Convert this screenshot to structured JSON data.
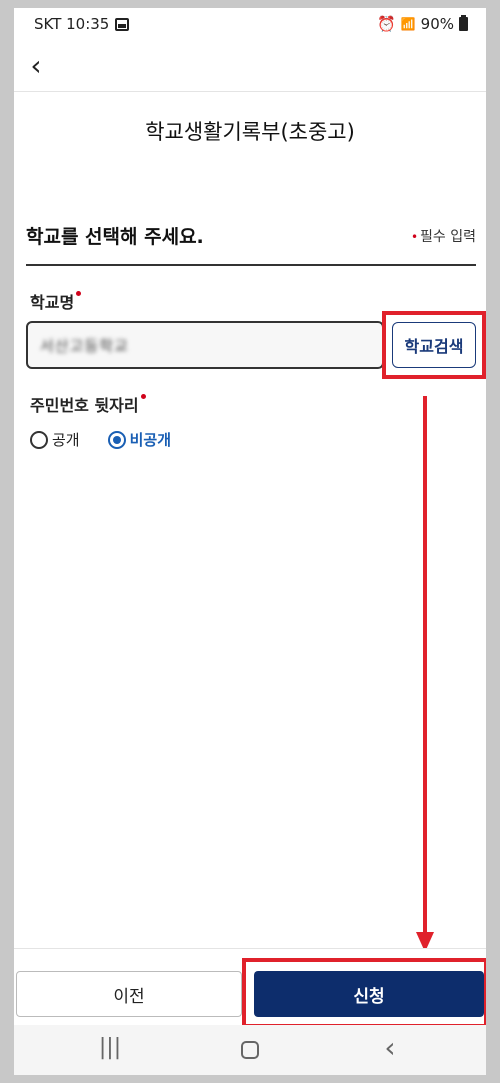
{
  "status_bar": {
    "carrier_time": "SKT 10:35",
    "battery": "90%",
    "icons": [
      "gallery-icon",
      "alarm-icon",
      "wifi-icon",
      "signal-icon",
      "battery-icon"
    ]
  },
  "app_bar": {
    "back_icon": "chevron-left-icon",
    "back_glyph": "‹"
  },
  "page": {
    "title": "학교생활기록부(초중고)"
  },
  "section": {
    "title": "학교를 선택해 주세요.",
    "required_note": "필수 입력",
    "required_dot": "•"
  },
  "school_field": {
    "label": "학교명",
    "value": "서산고등학교",
    "search_button": "학교검색"
  },
  "id_field": {
    "label": "주민번호 뒷자리",
    "options": [
      "공개",
      "비공개"
    ],
    "selected": "비공개"
  },
  "footer": {
    "prev_label": "이전",
    "apply_label": "신청"
  },
  "nav_bar": {
    "recent_glyph": "|||",
    "back_glyph": "‹",
    "icons": [
      "recent-apps-icon",
      "home-icon",
      "back-icon"
    ]
  },
  "colors": {
    "accent": "#0d2d6c",
    "link": "#1a5fb4",
    "required": "#d0021b",
    "annotation": "#e0212b"
  }
}
